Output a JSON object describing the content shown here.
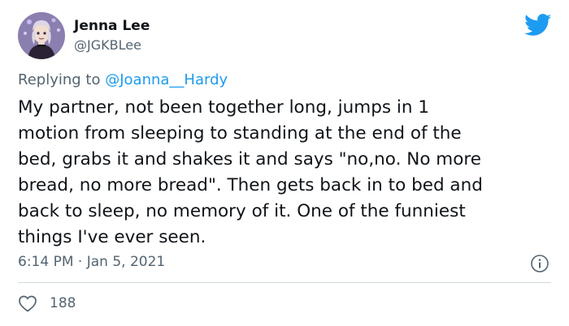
{
  "author": {
    "name": "Jenna Lee",
    "handle": "@JGKBLee",
    "avatar_icon": "avatar-illustration"
  },
  "brand": {
    "logo_icon": "twitter-bird-icon",
    "accent_color": "#1d9bf0"
  },
  "reply": {
    "prefix": "Replying to",
    "handle": "@Joanna__Hardy"
  },
  "body_lines": [
    "My partner, not been together long, jumps in 1",
    "motion from sleeping to standing at the end of the",
    "bed, grabs it and shakes it and says \"no,no. No more",
    "bread, no more bread\". Then gets back in to bed and",
    "back to sleep, no memory of it. One of the funniest",
    "things I've ever seen."
  ],
  "meta": {
    "timestamp": "6:14 PM · Jan 5, 2021",
    "info_icon": "info-icon"
  },
  "actions": {
    "like_icon": "heart-icon",
    "like_count": "188"
  }
}
